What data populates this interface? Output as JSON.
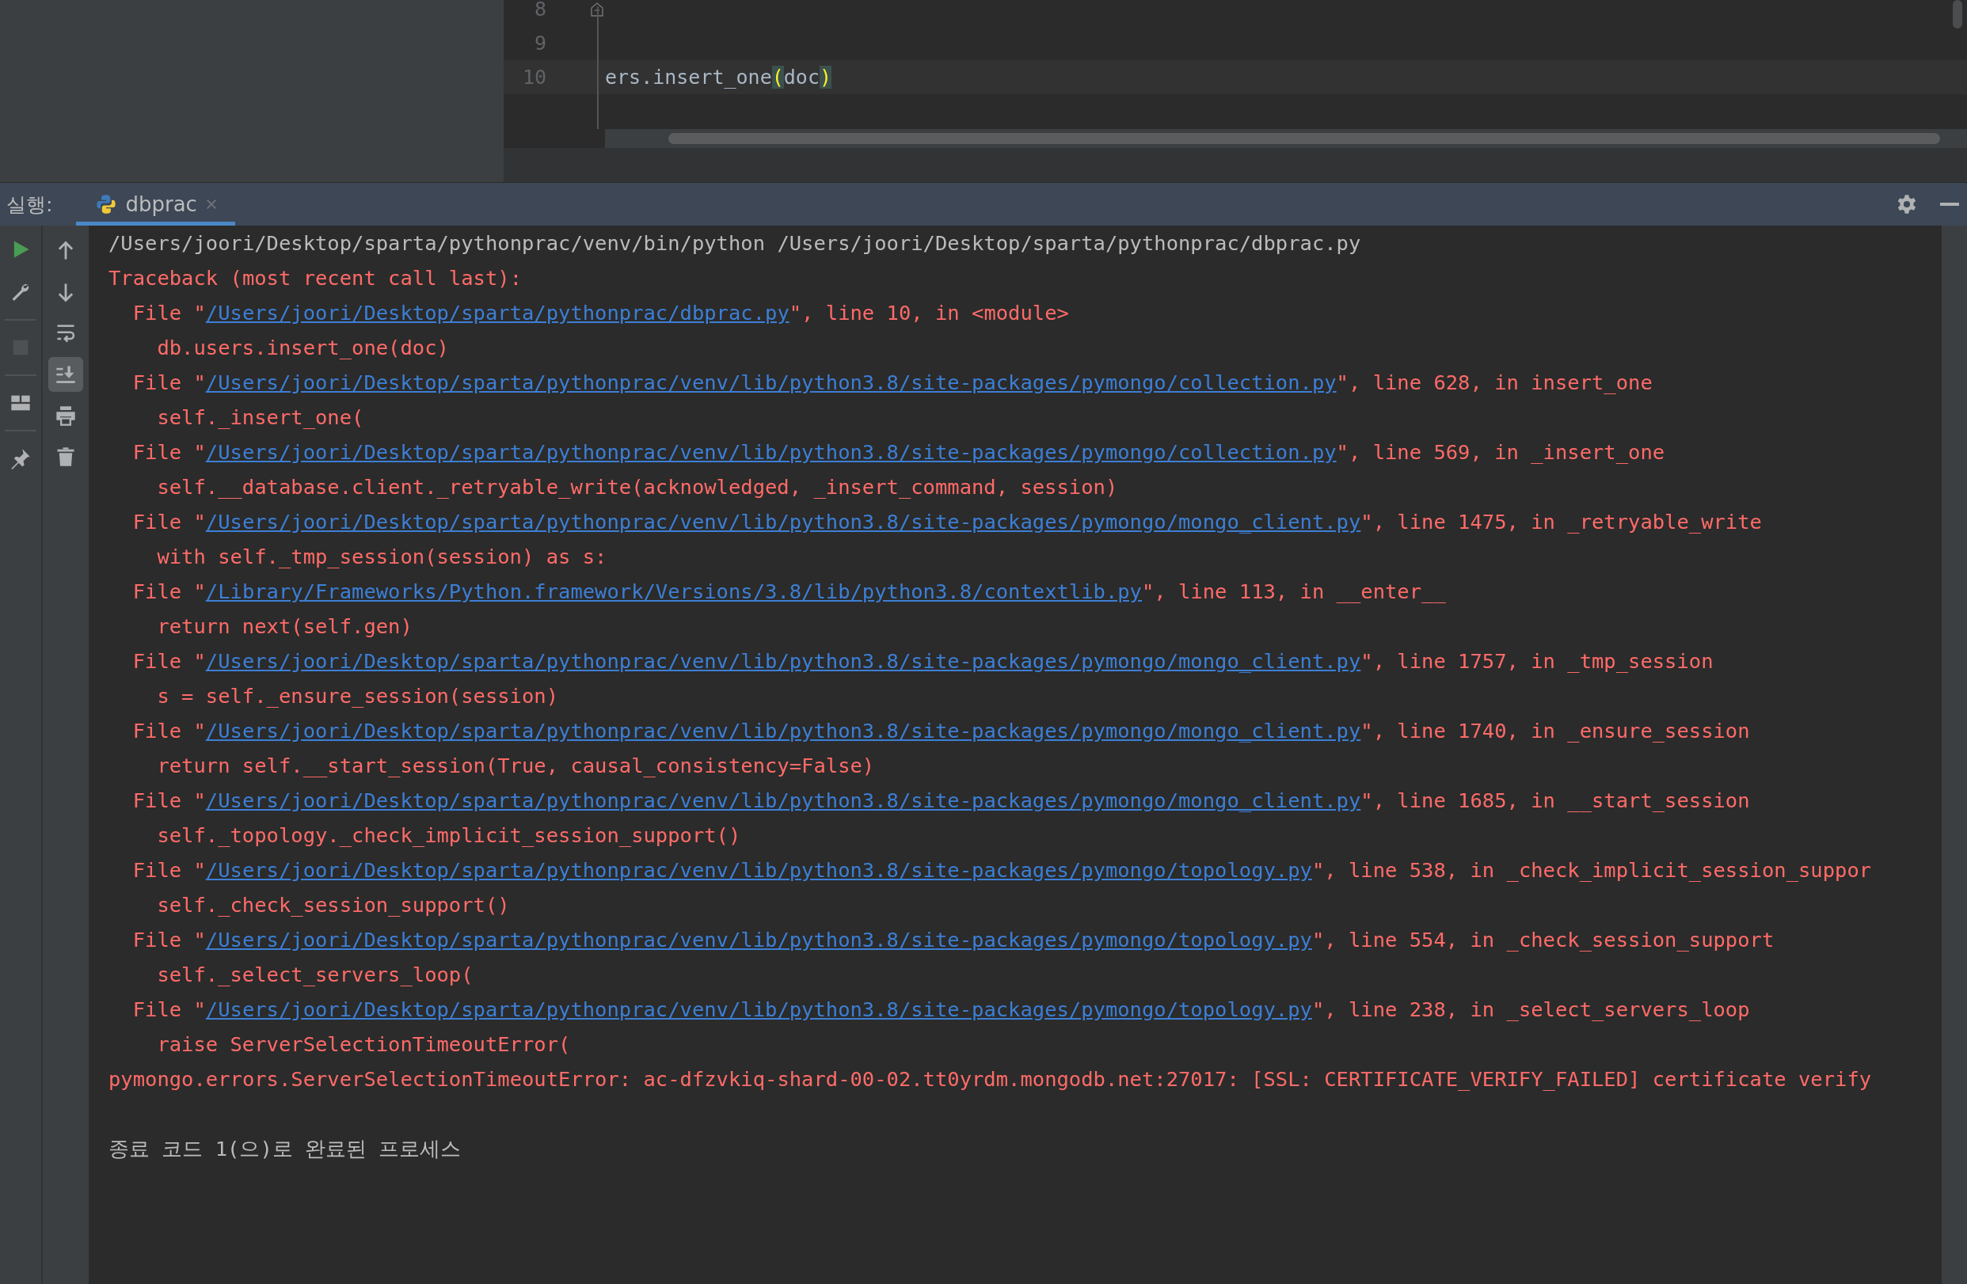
{
  "editor": {
    "lines": [
      {
        "number": "8",
        "fold": true,
        "current": false
      },
      {
        "number": "9",
        "fold": false,
        "current": false
      },
      {
        "number": "10",
        "fold": false,
        "current": true,
        "segments": [
          {
            "text": "ers.insert_one",
            "kind": "plain"
          },
          {
            "text": "(",
            "kind": "brace"
          },
          {
            "text": "doc",
            "kind": "plain"
          },
          {
            "text": ")",
            "kind": "brace"
          }
        ]
      }
    ]
  },
  "run_panel": {
    "label": "실행:",
    "tabs": [
      {
        "label": "dbprac",
        "selected": true
      }
    ]
  },
  "left_toolbar": [
    [
      {
        "kind": "run",
        "disabled": false
      },
      {
        "kind": "wrench",
        "disabled": false
      }
    ],
    [
      {
        "kind": "stop",
        "disabled": true
      }
    ],
    [
      {
        "kind": "layout",
        "disabled": false
      }
    ],
    [
      {
        "kind": "pin",
        "disabled": false
      }
    ]
  ],
  "console_toolbar": [
    {
      "kind": "up",
      "on": false
    },
    {
      "kind": "down",
      "on": false
    },
    {
      "kind": "wrap",
      "on": false
    },
    {
      "kind": "scroll-end",
      "on": true
    },
    {
      "kind": "print",
      "on": false
    },
    {
      "kind": "trash",
      "on": false
    }
  ],
  "console": [
    {
      "kind": "command",
      "text": "/Users/joori/Desktop/sparta/pythonprac/venv/bin/python /Users/joori/Desktop/sparta/pythonprac/dbprac.py"
    },
    {
      "kind": "error",
      "text": "Traceback (most recent call last):"
    },
    {
      "kind": "frame",
      "prefix": "File \"",
      "link": "/Users/joori/Desktop/sparta/pythonprac/dbprac.py",
      "suffix": "\", line 10, in <module>"
    },
    {
      "kind": "code",
      "text": "db.users.insert_one(doc)"
    },
    {
      "kind": "frame",
      "prefix": "File \"",
      "link": "/Users/joori/Desktop/sparta/pythonprac/venv/lib/python3.8/site-packages/pymongo/collection.py",
      "suffix": "\", line 628, in insert_one"
    },
    {
      "kind": "code",
      "text": "self._insert_one("
    },
    {
      "kind": "frame",
      "prefix": "File \"",
      "link": "/Users/joori/Desktop/sparta/pythonprac/venv/lib/python3.8/site-packages/pymongo/collection.py",
      "suffix": "\", line 569, in _insert_one"
    },
    {
      "kind": "code",
      "text": "self.__database.client._retryable_write(acknowledged, _insert_command, session)"
    },
    {
      "kind": "frame",
      "prefix": "File \"",
      "link": "/Users/joori/Desktop/sparta/pythonprac/venv/lib/python3.8/site-packages/pymongo/mongo_client.py",
      "suffix": "\", line 1475, in _retryable_write"
    },
    {
      "kind": "code",
      "text": "with self._tmp_session(session) as s:"
    },
    {
      "kind": "frame",
      "prefix": "File \"",
      "link": "/Library/Frameworks/Python.framework/Versions/3.8/lib/python3.8/contextlib.py",
      "suffix": "\", line 113, in __enter__"
    },
    {
      "kind": "code",
      "text": "return next(self.gen)"
    },
    {
      "kind": "frame",
      "prefix": "File \"",
      "link": "/Users/joori/Desktop/sparta/pythonprac/venv/lib/python3.8/site-packages/pymongo/mongo_client.py",
      "suffix": "\", line 1757, in _tmp_session"
    },
    {
      "kind": "code",
      "text": "s = self._ensure_session(session)"
    },
    {
      "kind": "frame",
      "prefix": "File \"",
      "link": "/Users/joori/Desktop/sparta/pythonprac/venv/lib/python3.8/site-packages/pymongo/mongo_client.py",
      "suffix": "\", line 1740, in _ensure_session"
    },
    {
      "kind": "code",
      "text": "return self.__start_session(True, causal_consistency=False)"
    },
    {
      "kind": "frame",
      "prefix": "File \"",
      "link": "/Users/joori/Desktop/sparta/pythonprac/venv/lib/python3.8/site-packages/pymongo/mongo_client.py",
      "suffix": "\", line 1685, in __start_session"
    },
    {
      "kind": "code",
      "text": "self._topology._check_implicit_session_support()"
    },
    {
      "kind": "frame",
      "prefix": "File \"",
      "link": "/Users/joori/Desktop/sparta/pythonprac/venv/lib/python3.8/site-packages/pymongo/topology.py",
      "suffix": "\", line 538, in _check_implicit_session_suppor"
    },
    {
      "kind": "code",
      "text": "self._check_session_support()"
    },
    {
      "kind": "frame",
      "prefix": "File \"",
      "link": "/Users/joori/Desktop/sparta/pythonprac/venv/lib/python3.8/site-packages/pymongo/topology.py",
      "suffix": "\", line 554, in _check_session_support"
    },
    {
      "kind": "code",
      "text": "self._select_servers_loop("
    },
    {
      "kind": "frame",
      "prefix": "File \"",
      "link": "/Users/joori/Desktop/sparta/pythonprac/venv/lib/python3.8/site-packages/pymongo/topology.py",
      "suffix": "\", line 238, in _select_servers_loop"
    },
    {
      "kind": "code",
      "text": "raise ServerSelectionTimeoutError("
    },
    {
      "kind": "error",
      "text": "pymongo.errors.ServerSelectionTimeoutError: ac-dfzvkiq-shard-00-02.tt0yrdm.mongodb.net:27017: [SSL: CERTIFICATE_VERIFY_FAILED] certificate verify"
    },
    {
      "kind": "blank"
    },
    {
      "kind": "exit",
      "text": "종료 코드 1(으)로 완료된 프로세스"
    }
  ]
}
